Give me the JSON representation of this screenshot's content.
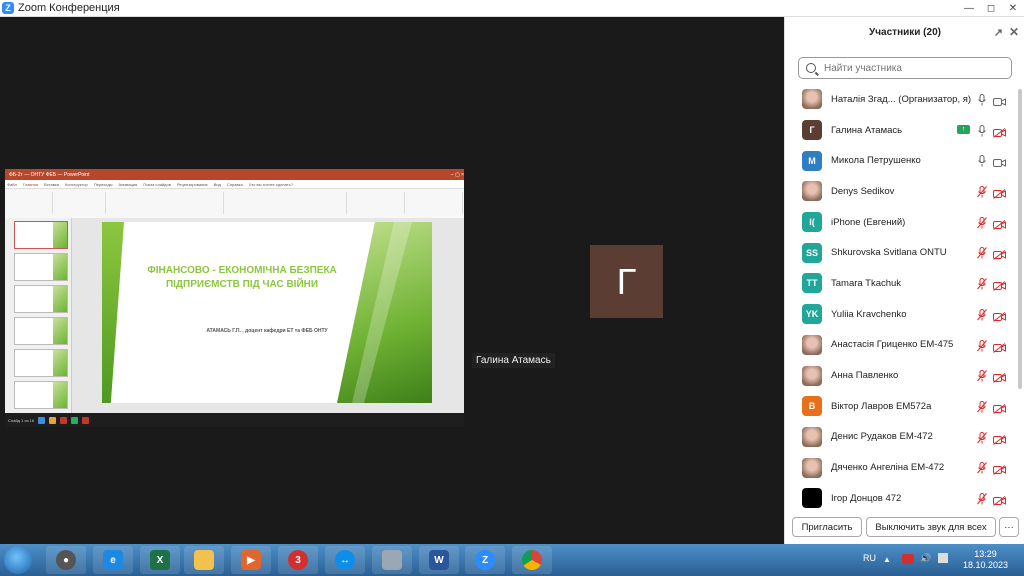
{
  "window": {
    "title": "Zoom Конференция"
  },
  "share": {
    "ppt_title": "ФБ-2т — ОНТУ ФЕБ — PowerPoint",
    "tabs": [
      "Файл",
      "Главная",
      "Вставка",
      "Конструктор",
      "Переходы",
      "Анимация",
      "Показ слайдов",
      "Рецензирование",
      "Вид",
      "Справка",
      "Что вы хотите сделать?"
    ],
    "slide_title": "ФІНАНСОВО - ЕКОНОМІЧНА БЕЗПЕКА ПІДПРИЄМСТВ ПІД ЧАС ВІЙНИ",
    "slide_subtitle": "АТАМАСЬ Г.П. , доцент кафедри ЕТ та ФЕБ ОНТУ",
    "slide_count": "Слайд 1 из 16"
  },
  "speaker_tile": {
    "initial": "Г",
    "name": "Галина Атамась"
  },
  "panel": {
    "title": "Участники (20)",
    "search_placeholder": "Найти участника",
    "participants": [
      {
        "initials": "",
        "avatar_color": "#d9b59a",
        "photo": true,
        "name": "Наталія Згад... (Организатор, я)",
        "muted": false,
        "video": true,
        "sharing": false
      },
      {
        "initials": "Г",
        "avatar_color": "#5c3d33",
        "photo": false,
        "name": "Галина Атамась",
        "muted": false,
        "video": false,
        "sharing": true
      },
      {
        "initials": "M",
        "avatar_color": "#2f7ec4",
        "photo": false,
        "name": "Микола Петрушенко",
        "muted": false,
        "video": true,
        "sharing": false
      },
      {
        "initials": "",
        "avatar_color": "#7a5a4a",
        "photo": true,
        "name": "Denys Sedikov",
        "muted": true,
        "video": false,
        "sharing": false
      },
      {
        "initials": "I(",
        "avatar_color": "#21a69a",
        "photo": false,
        "name": "iPhone (Евгений)",
        "muted": true,
        "video": false,
        "sharing": false
      },
      {
        "initials": "SS",
        "avatar_color": "#21a69a",
        "photo": false,
        "name": "Shkurovska Svitlana ONTU",
        "muted": true,
        "video": false,
        "sharing": false
      },
      {
        "initials": "TT",
        "avatar_color": "#21a69a",
        "photo": false,
        "name": "Tamara Tkachuk",
        "muted": true,
        "video": false,
        "sharing": false
      },
      {
        "initials": "YK",
        "avatar_color": "#21a69a",
        "photo": false,
        "name": "Yuliia Kravchenko",
        "muted": true,
        "video": false,
        "sharing": false
      },
      {
        "initials": "",
        "avatar_color": "#c24a6a",
        "photo": true,
        "name": "Анастасія Гриценко ЕМ-475",
        "muted": true,
        "video": false,
        "sharing": false
      },
      {
        "initials": "",
        "avatar_color": "#d9b59a",
        "photo": true,
        "name": "Анна Павленко",
        "muted": true,
        "video": false,
        "sharing": false
      },
      {
        "initials": "B",
        "avatar_color": "#e8701a",
        "photo": false,
        "name": "Віктор Лавров ЕМ572а",
        "muted": true,
        "video": false,
        "sharing": false
      },
      {
        "initials": "",
        "avatar_color": "#4a4a4a",
        "photo": true,
        "name": "Денис Рудаков ЕМ-472",
        "muted": true,
        "video": false,
        "sharing": false
      },
      {
        "initials": "",
        "avatar_color": "#9a7a6a",
        "photo": true,
        "name": "Дяченко Ангеліна ЕМ-472",
        "muted": true,
        "video": false,
        "sharing": false
      },
      {
        "initials": "",
        "avatar_color": "#000000",
        "photo": false,
        "name": "Ігор Донцов 472",
        "muted": true,
        "video": false,
        "sharing": false
      }
    ],
    "invite_label": "Пригласить",
    "mute_all_label": "Выключить звук для всех",
    "more_label": "···"
  },
  "taskbar": {
    "language": "RU",
    "time": "13:29",
    "date": "18.10.2023"
  },
  "colors": {
    "zoom_blue": "#2d8cff",
    "mute_red": "#e02828",
    "slide_green": "#8dc63f"
  }
}
